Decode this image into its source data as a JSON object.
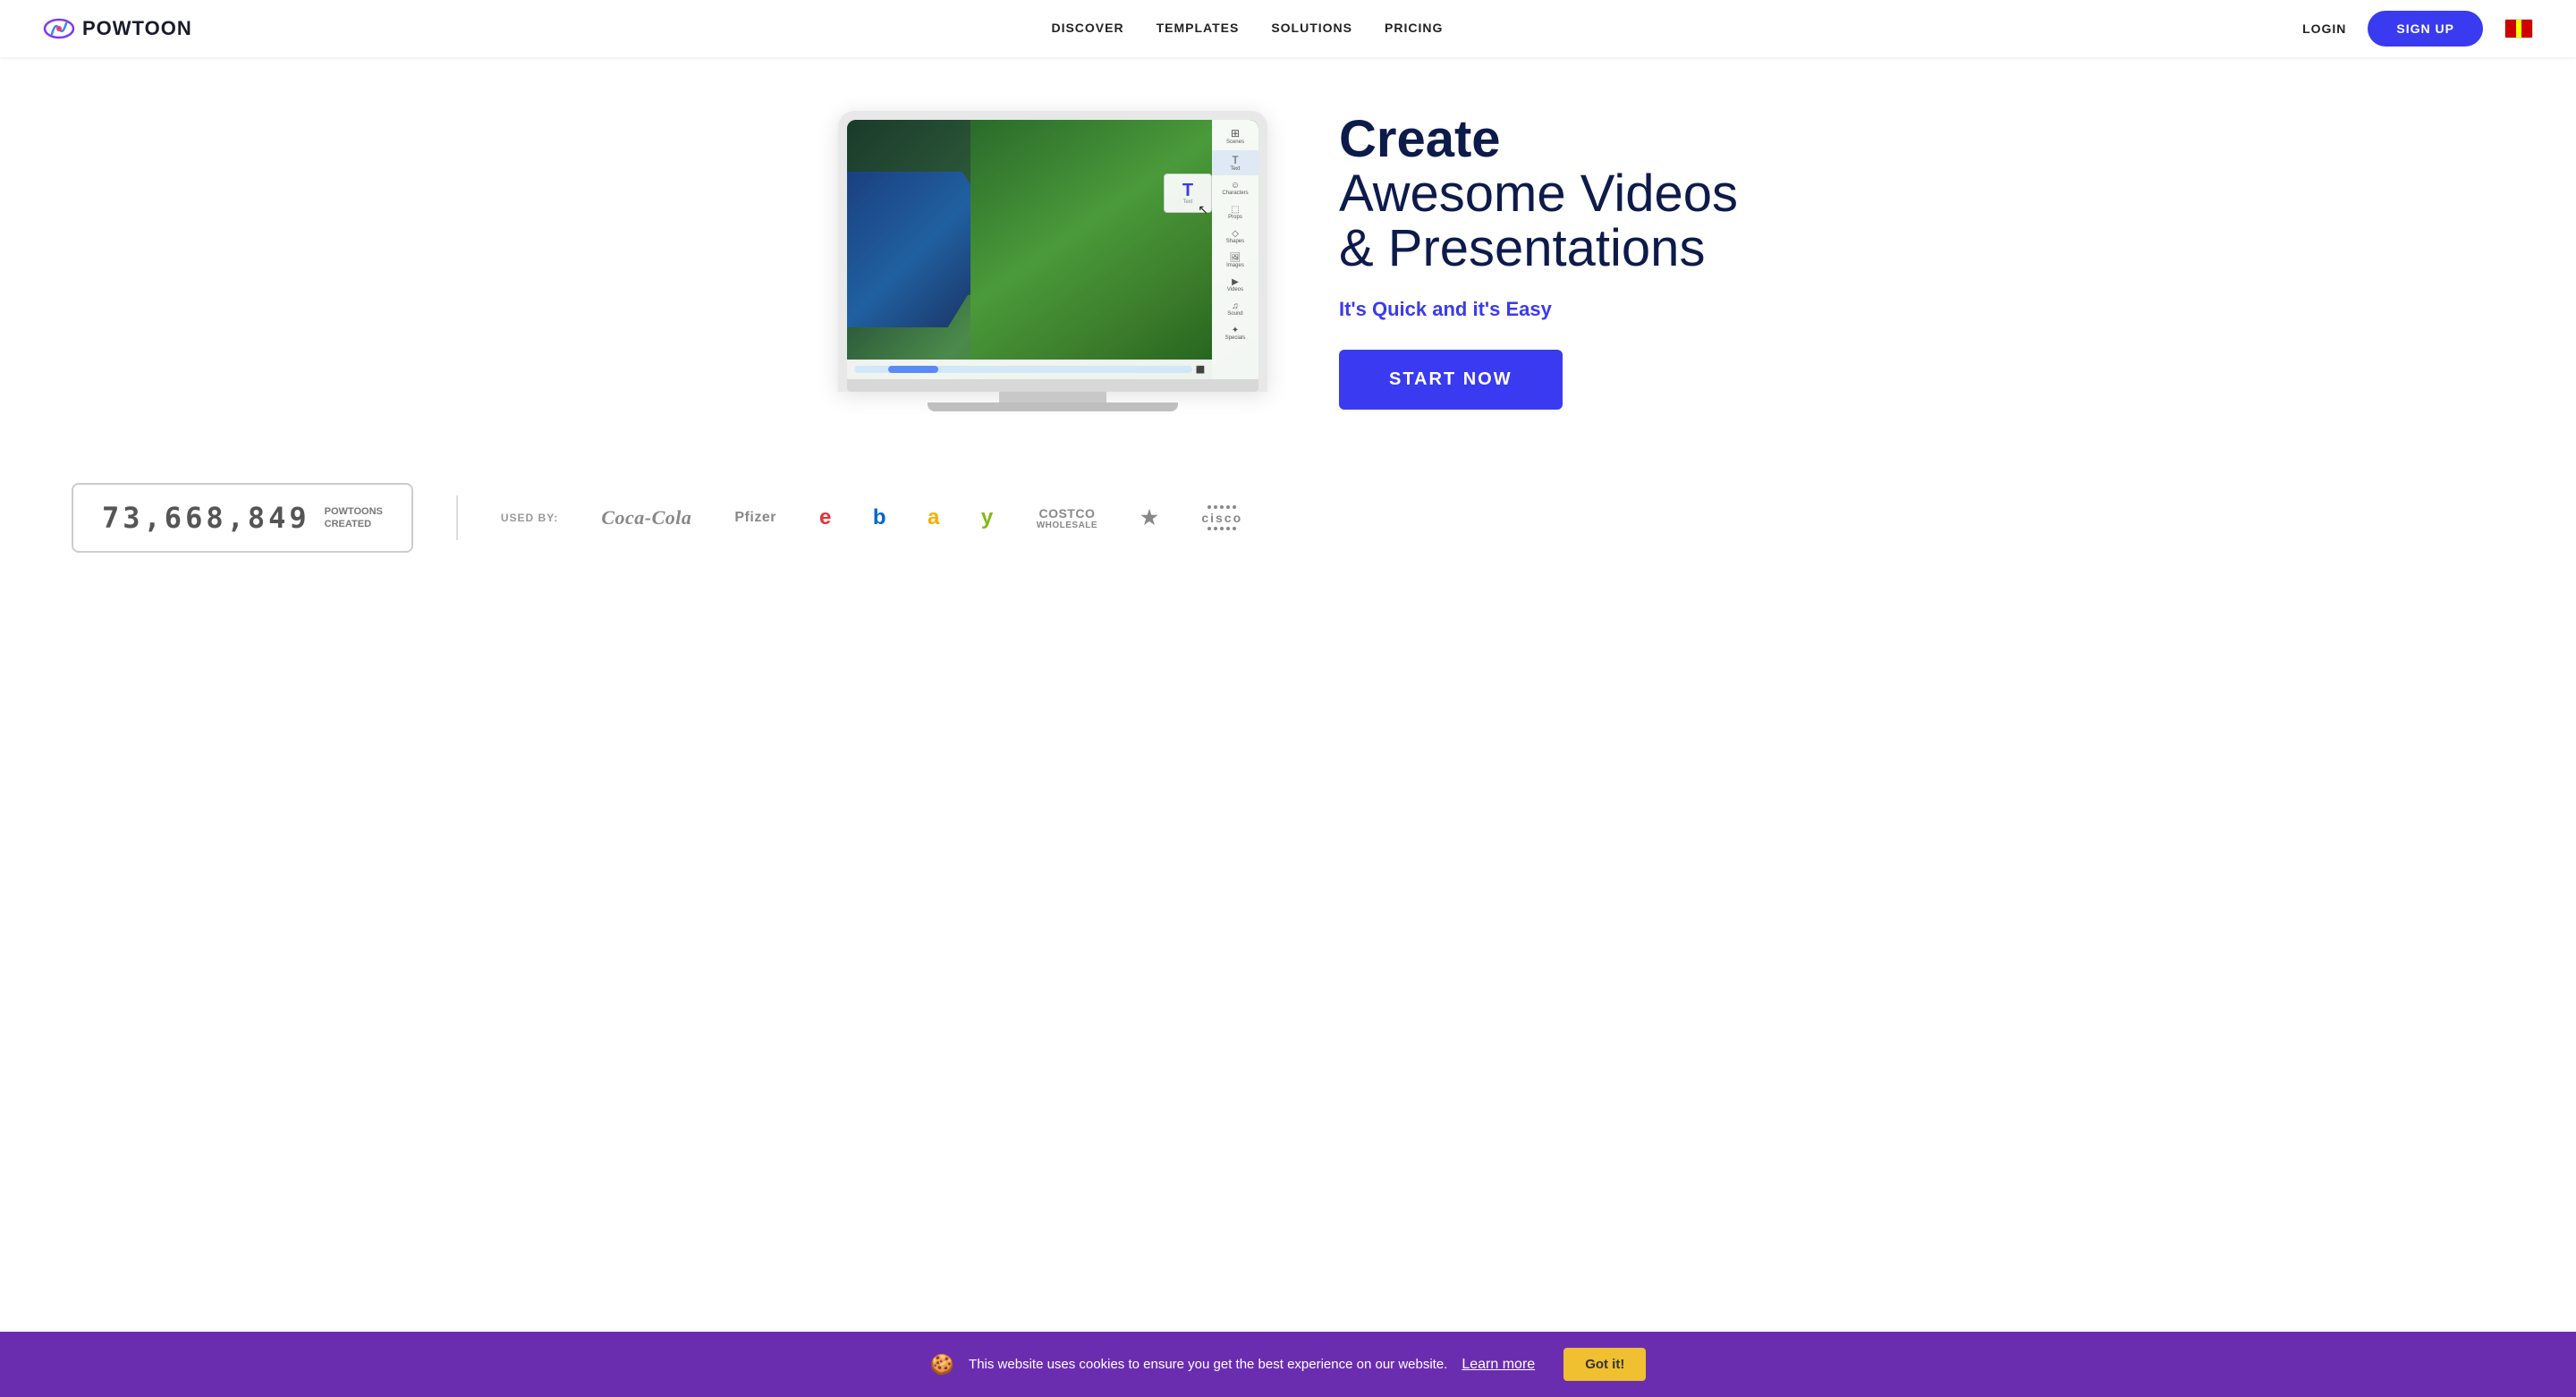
{
  "nav": {
    "logo_text": "POWTOON",
    "links": [
      {
        "label": "DISCOVER",
        "id": "discover"
      },
      {
        "label": "TEMPLATES",
        "id": "templates"
      },
      {
        "label": "SOLUTIONS",
        "id": "solutions"
      },
      {
        "label": "PRICING",
        "id": "pricing"
      }
    ],
    "login_label": "LOGIN",
    "signup_label": "SIGN UP"
  },
  "hero": {
    "headline_bold": "Create",
    "headline_rest": "Awesome Videos\n& Presentations",
    "subtitle": "It's Quick and it's Easy",
    "cta_label": "START NOW",
    "toolbar_items": [
      {
        "icon": "⊞",
        "label": "Scenes"
      },
      {
        "icon": "T",
        "label": "Text",
        "active": true
      },
      {
        "icon": "☺",
        "label": "Characters"
      },
      {
        "icon": "🗃",
        "label": "Props"
      },
      {
        "icon": "◇",
        "label": "Shapes"
      },
      {
        "icon": "🖼",
        "label": "Images"
      },
      {
        "icon": "▶",
        "label": "Videos"
      },
      {
        "icon": "♫",
        "label": "Sound"
      },
      {
        "icon": "✦",
        "label": "Specials"
      }
    ]
  },
  "stats": {
    "counter": "73,668,849",
    "counter_label_line1": "POWTOONS",
    "counter_label_line2": "CREATED",
    "used_by_label": "USED BY:"
  },
  "brands": [
    {
      "name": "Coca‑Cola",
      "style": "coca"
    },
    {
      "name": "Pfizer",
      "style": "pfizer"
    },
    {
      "name": "ebay",
      "style": "ebay"
    },
    {
      "name": "COSTCO\nWHOLESALE",
      "style": "costco"
    },
    {
      "name": "★",
      "style": "starbucks"
    },
    {
      "name": "CISCO",
      "style": "cisco"
    }
  ],
  "cookie": {
    "text": "This website uses cookies to ensure you get the best experience on our website.",
    "link_text": "Learn more",
    "btn_label": "Got it!"
  },
  "colors": {
    "brand_blue": "#3a3af0",
    "dark_navy": "#0d1b4b",
    "purple_banner": "#6b2db0",
    "cookie_yellow": "#f0c030"
  }
}
